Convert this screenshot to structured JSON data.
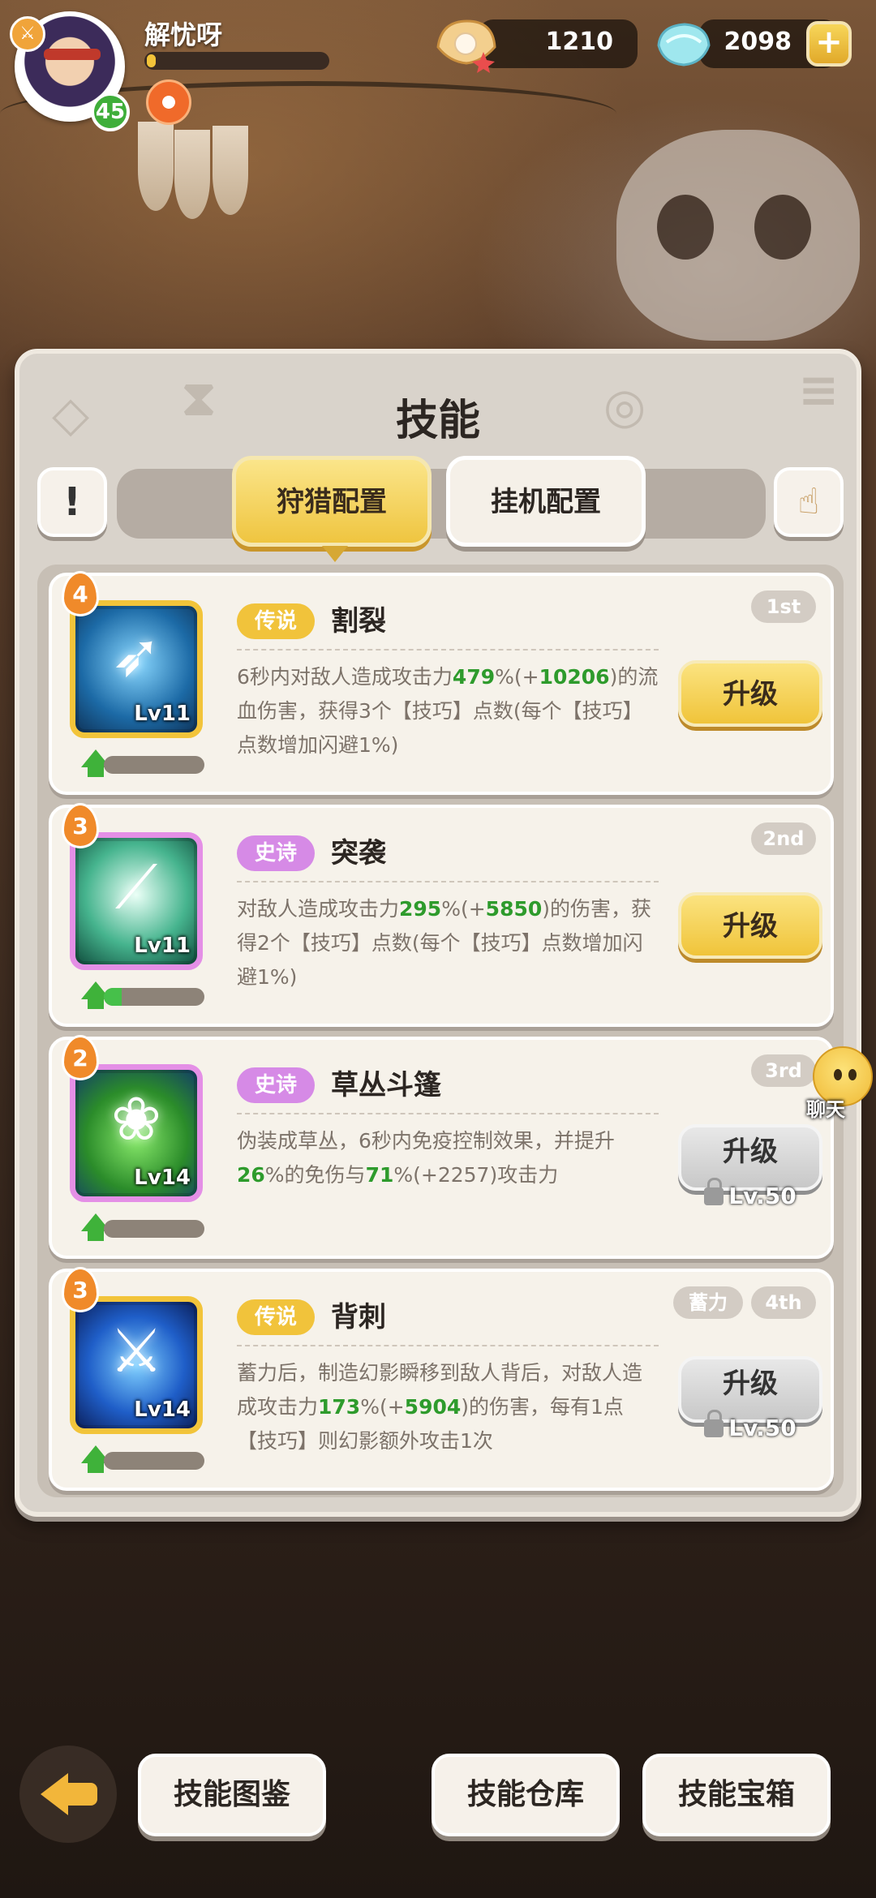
{
  "player": {
    "name": "解忧呀",
    "level": "45",
    "xp_fraction": 0.05
  },
  "currencies": [
    {
      "icon": "shell-pearl-icon",
      "value": "1210"
    },
    {
      "icon": "crystal-gem-icon",
      "value": "2098"
    }
  ],
  "panel": {
    "title": "技能",
    "tabs": [
      {
        "label": "狩猎配置",
        "active": true
      },
      {
        "label": "挂机配置",
        "active": false
      }
    ]
  },
  "skills": [
    {
      "star": "4",
      "icon_level": "Lv11",
      "rarity": "传说",
      "name": "割裂",
      "rank": "1st",
      "tag": "",
      "desc_parts": [
        "6秒内对敌人造成攻击力",
        "479",
        "%(+",
        "10206",
        ")的流血伤害，获得3个【技巧】点数(每个【技巧】点数增加闪避1%)"
      ],
      "button": "升级",
      "locked": false,
      "lock_text": "",
      "progress": 0.0
    },
    {
      "star": "3",
      "icon_level": "Lv11",
      "rarity": "史诗",
      "name": "突袭",
      "rank": "2nd",
      "tag": "",
      "desc_parts": [
        "对敌人造成攻击力",
        "295",
        "%(+",
        "5850",
        ")的伤害，获得2个【技巧】点数(每个【技巧】点数增加闪避1%)"
      ],
      "button": "升级",
      "locked": false,
      "lock_text": "",
      "progress": 0.18
    },
    {
      "star": "2",
      "icon_level": "Lv14",
      "rarity": "史诗",
      "name": "草丛斗篷",
      "rank": "3rd",
      "tag": "",
      "desc_parts": [
        "伪装成草丛，6秒内免疫控制效果，并提升",
        "26",
        "%的免伤与",
        "71",
        "%(+2257)攻击力"
      ],
      "button": "升级",
      "locked": true,
      "lock_text": "Lv.50",
      "progress": 0.0
    },
    {
      "star": "3",
      "icon_level": "Lv14",
      "rarity": "传说",
      "name": "背刺",
      "rank": "4th",
      "tag": "蓄力",
      "desc_parts": [
        "蓄力后，制造幻影瞬移到敌人背后，对敌人造成攻击力",
        "173",
        "%(+",
        "5904",
        ")的伤害，每有1点【技巧】则幻影额外攻击1次"
      ],
      "button": "升级",
      "locked": true,
      "lock_text": "Lv.50",
      "progress": 0.0
    }
  ],
  "chat": {
    "label": "聊天"
  },
  "bottom": {
    "buttons": [
      "技能图鉴",
      "技能仓库",
      "技能宝箱"
    ]
  },
  "colors": {
    "legend": "#f1c33b",
    "epic": "#d68ae6",
    "highlight_green": "#2e9b2c",
    "upgrade_yellow": "#f0c43a"
  }
}
